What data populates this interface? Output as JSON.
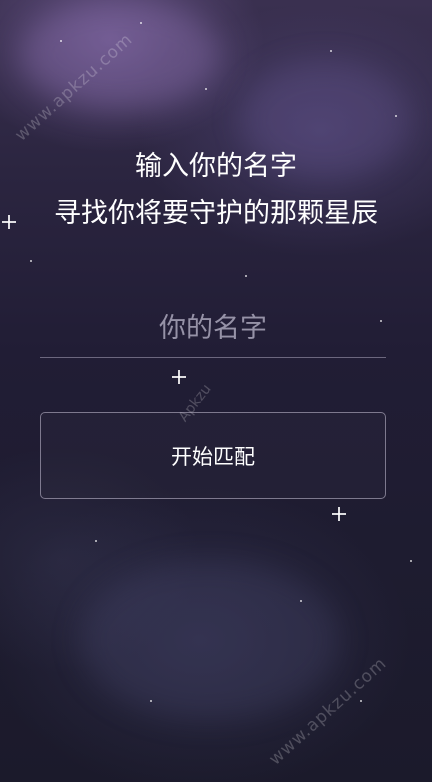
{
  "headline": {
    "line1": "输入你的名字",
    "line2": "寻找你将要守护的那颗星辰"
  },
  "name_input": {
    "placeholder": "你的名字",
    "value": ""
  },
  "match_button": {
    "label": "开始匹配"
  },
  "watermarks": {
    "top": "www.apkzu.com",
    "middle": "Apkzu",
    "bottom": "www.apkzu.com"
  },
  "colors": {
    "background_top": "#3a3050",
    "background_bottom": "#1b1a2b",
    "text": "#ffffff",
    "placeholder": "#bebacd",
    "border": "#c8c3d7"
  }
}
